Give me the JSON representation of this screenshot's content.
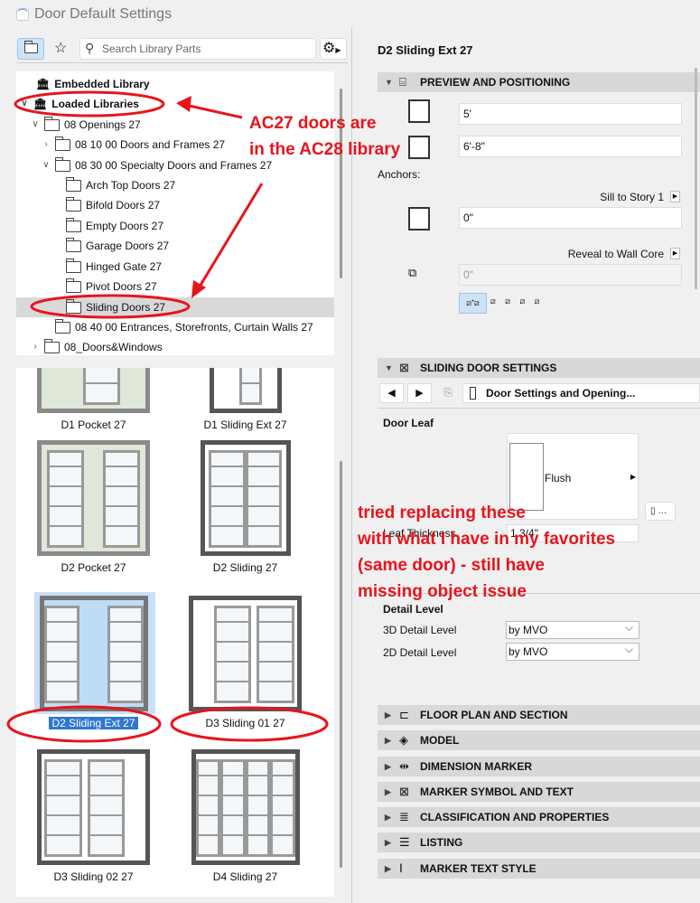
{
  "window": {
    "title": "Door Default Settings"
  },
  "toolbar": {
    "search_placeholder": "Search Library Parts"
  },
  "tree": [
    {
      "label": "Embedded Library",
      "bold": true
    },
    {
      "label": "Loaded Libraries",
      "bold": true
    },
    {
      "label": "08 Openings 27"
    },
    {
      "label": "08 10 00 Doors and Frames 27"
    },
    {
      "label": "08 30 00 Specialty Doors and Frames 27"
    },
    {
      "label": "Arch Top Doors 27"
    },
    {
      "label": "Bifold Doors 27"
    },
    {
      "label": "Empty Doors 27"
    },
    {
      "label": "Garage Doors 27"
    },
    {
      "label": "Hinged Gate 27"
    },
    {
      "label": "Pivot Doors 27"
    },
    {
      "label": "Sliding Doors 27",
      "selected": true
    },
    {
      "label": "08 40 00 Entrances, Storefronts, Curtain Walls 27"
    },
    {
      "label": "08_Doors&Windows"
    }
  ],
  "thumbnails": [
    {
      "label": "D1 Pocket 27"
    },
    {
      "label": "D1 Sliding Ext 27"
    },
    {
      "label": "D2 Pocket 27"
    },
    {
      "label": "D2 Sliding 27"
    },
    {
      "label": "D2 Sliding Ext 27",
      "selected": true
    },
    {
      "label": "D3 Sliding 01 27"
    },
    {
      "label": "D3 Sliding 02 27"
    },
    {
      "label": "D4 Sliding 27"
    }
  ],
  "right": {
    "object_name": "D2 Sliding Ext 27",
    "preview_section": "PREVIEW AND POSITIONING",
    "width": "5'",
    "height": "6'-8\"",
    "anchors_label": "Anchors:",
    "sill_label": "Sill to Story 1",
    "sill_value": "0\"",
    "reveal_label": "Reveal to Wall Core",
    "reveal_value": "0\"",
    "sliding_section": "SLIDING DOOR SETTINGS",
    "page_select": "Door Settings and Opening...",
    "door_leaf_label": "Door Leaf",
    "leaf_type": "Flush",
    "leaf_thickness_label": "Leaf Thickness",
    "leaf_thickness": "1 3/4\"",
    "detail_label": "Detail Level",
    "detail_3d_label": "3D Detail Level",
    "detail_3d": "by MVO",
    "detail_2d_label": "2D Detail Level",
    "detail_2d": "by MVO",
    "sections": [
      "FLOOR PLAN AND SECTION",
      "MODEL",
      "DIMENSION MARKER",
      "MARKER SYMBOL AND TEXT",
      "CLASSIFICATION AND PROPERTIES",
      "LISTING",
      "MARKER TEXT STYLE"
    ]
  },
  "annotations": {
    "note1": [
      "AC27 doors are",
      "in the AC28 library"
    ],
    "note2": [
      "tried replacing these",
      "with what I have in my favorites",
      "(same door) - still have",
      "missing object issue"
    ],
    "color": "#e8141c"
  }
}
